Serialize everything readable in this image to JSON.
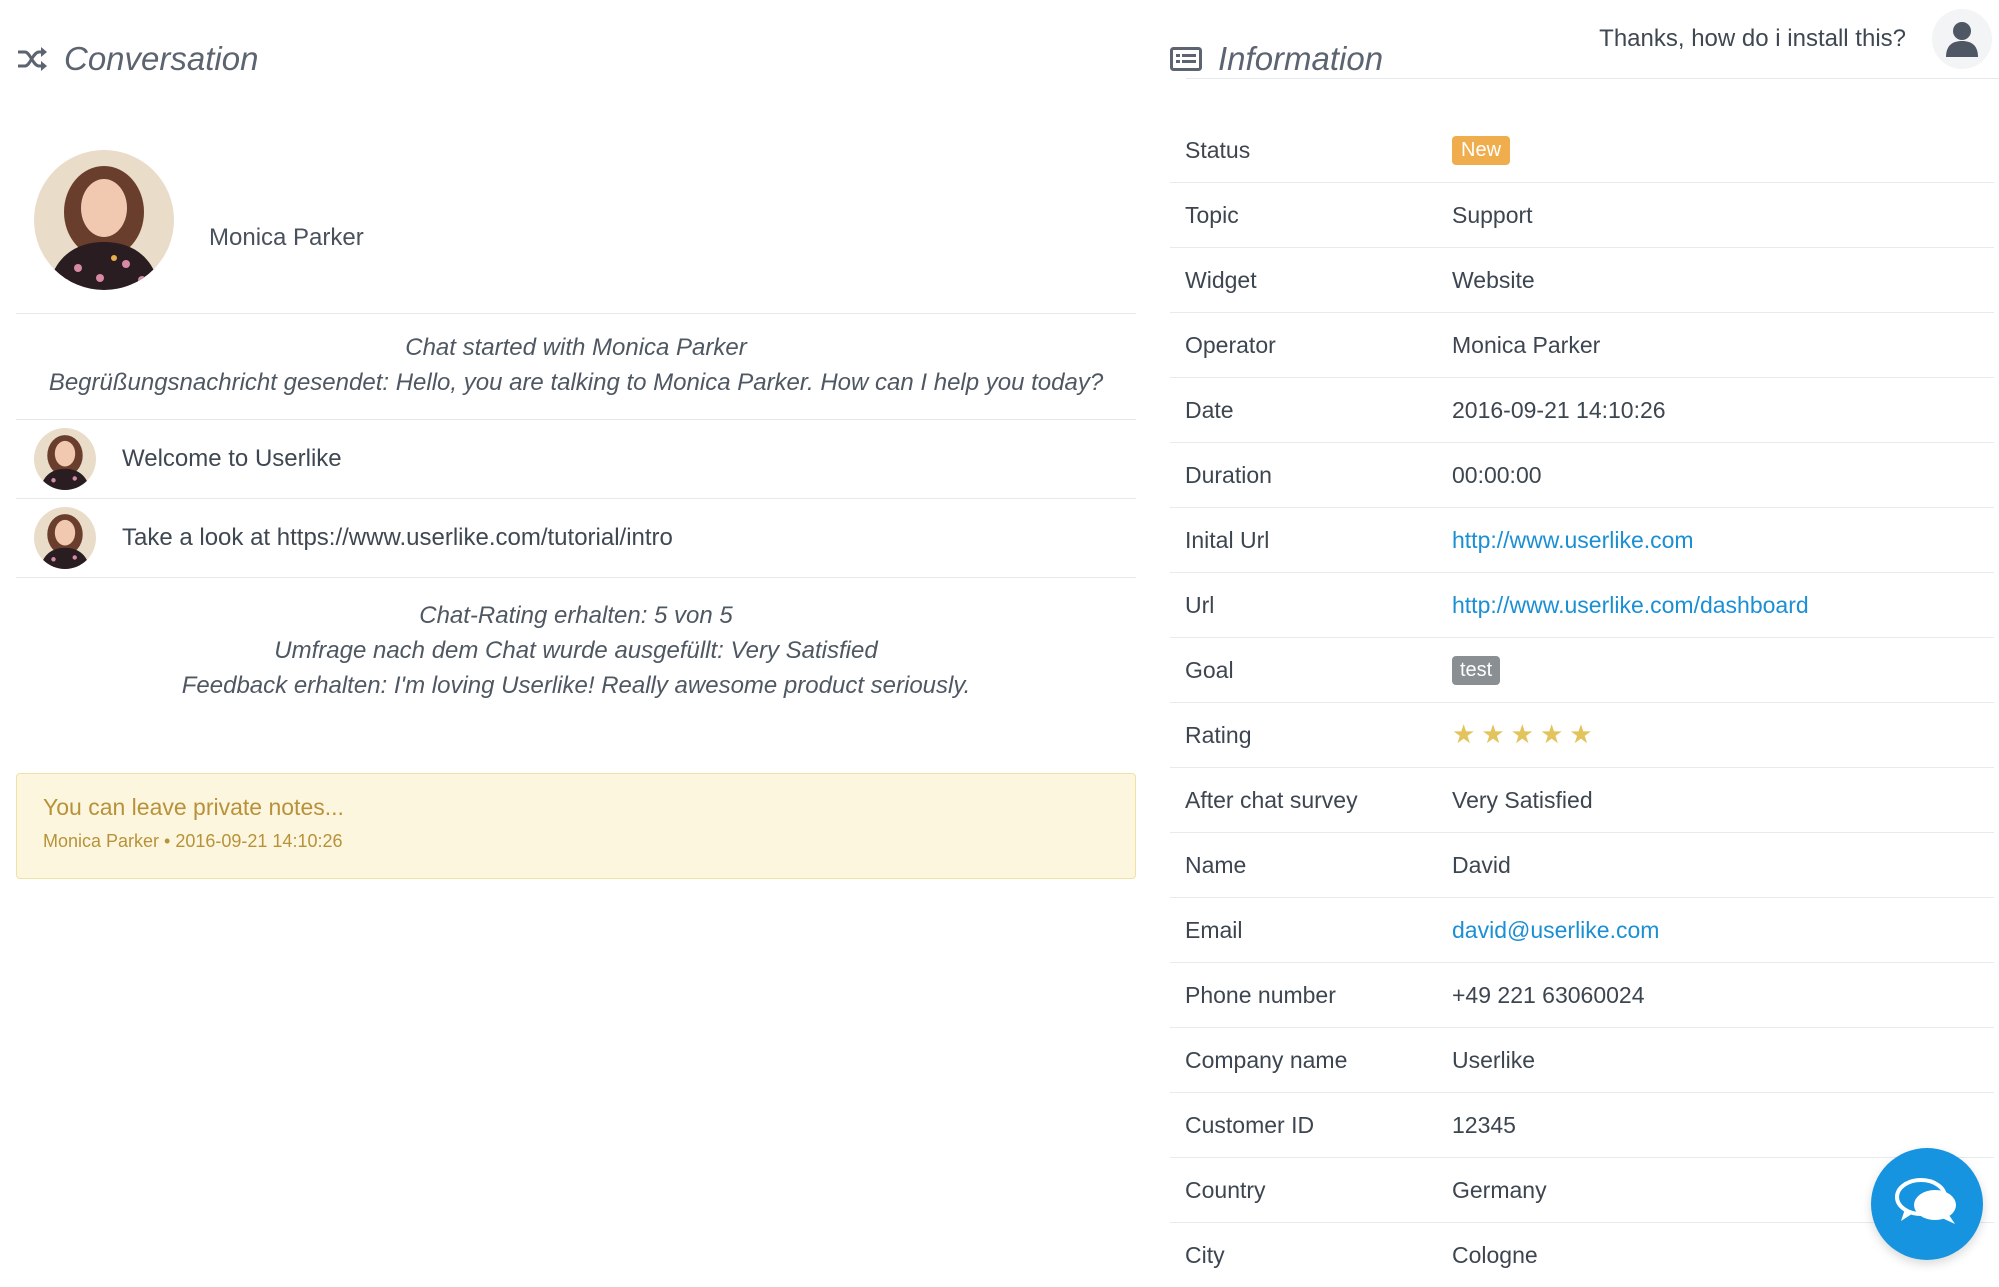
{
  "conversation": {
    "title": "Conversation",
    "contact_name": "Monica Parker",
    "system_start": {
      "line1": "Chat started with Monica Parker",
      "line2": "Begrüßungsnachricht gesendet: Hello, you are talking to Monica Parker. How can I help you today?"
    },
    "messages": [
      {
        "from": "operator",
        "text": "Welcome to Userlike"
      },
      {
        "from": "visitor",
        "text": "Thanks, how do i install this?"
      },
      {
        "from": "operator",
        "text": "Take a look at https://www.userlike.com/tutorial/intro"
      }
    ],
    "system_end": {
      "line1": "Chat-Rating erhalten: 5 von 5",
      "line2": "Umfrage nach dem Chat wurde ausgefüllt: Very Satisfied",
      "line3": "Feedback erhalten: I'm loving Userlike! Really awesome product seriously."
    },
    "note": {
      "placeholder": "You can leave private notes...",
      "meta": "Monica Parker • 2016-09-21 14:10:26"
    }
  },
  "information": {
    "title": "Information",
    "rows": [
      {
        "label": "Status",
        "value": "New"
      },
      {
        "label": "Topic",
        "value": "Support"
      },
      {
        "label": "Widget",
        "value": "Website"
      },
      {
        "label": "Operator",
        "value": "Monica Parker"
      },
      {
        "label": "Date",
        "value": "2016-09-21 14:10:26"
      },
      {
        "label": "Duration",
        "value": "00:00:00"
      },
      {
        "label": "Inital Url",
        "value": "http://www.userlike.com"
      },
      {
        "label": "Url",
        "value": "http://www.userlike.com/dashboard"
      },
      {
        "label": "Goal",
        "value": "test"
      },
      {
        "label": "Rating",
        "value": 5
      },
      {
        "label": "After chat survey",
        "value": "Very Satisfied"
      },
      {
        "label": "Name",
        "value": "David"
      },
      {
        "label": "Email",
        "value": "david@userlike.com"
      },
      {
        "label": "Phone number",
        "value": "+49 221 63060024"
      },
      {
        "label": "Company name",
        "value": "Userlike"
      },
      {
        "label": "Customer ID",
        "value": "12345"
      },
      {
        "label": "Country",
        "value": "Germany"
      },
      {
        "label": "City",
        "value": "Cologne"
      }
    ]
  },
  "icons": {
    "conversation": "shuffle-icon",
    "information": "list-icon",
    "visitor": "user-icon",
    "chat_fab": "chat-bubbles-icon",
    "star": "star-icon"
  },
  "colors": {
    "link": "#1b8fd4",
    "badge_new": "#f0ad4e",
    "badge_goal": "#8a8f94",
    "star": "#e3c35b",
    "note_bg": "#fcf6de",
    "note_text": "#b8923a",
    "fab": "#1794e0"
  }
}
